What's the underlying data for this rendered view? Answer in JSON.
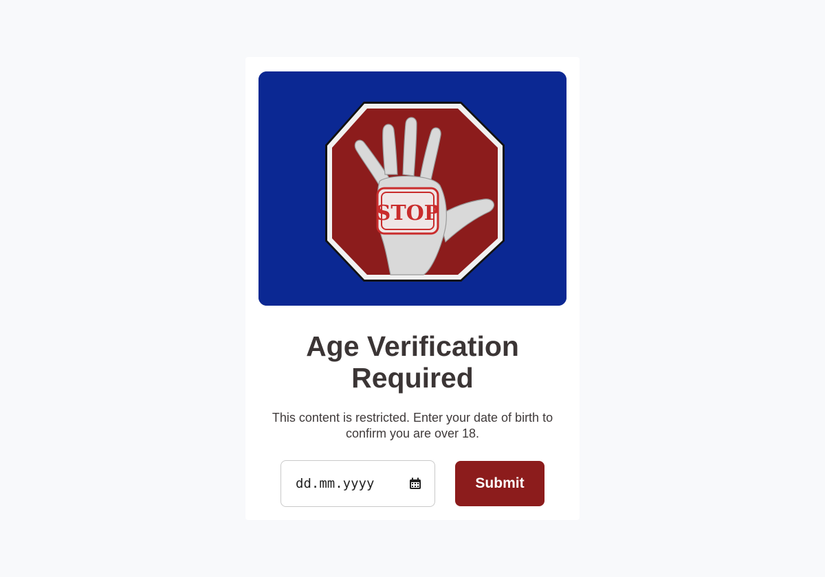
{
  "hero": {
    "icon": "stop-hand-icon",
    "sign_text": "STOP",
    "background_color": "#0b2893",
    "sign_color": "#8c1c1c"
  },
  "verification": {
    "title": "Age Verification Required",
    "description": "This content is restricted. Enter your date of birth to confirm you are over 18.",
    "date_placeholder": "dd.mm.yyyy",
    "date_value": "",
    "calendar_icon": "calendar-icon",
    "submit_label": "Submit",
    "accent_color": "#8c1c1c"
  }
}
